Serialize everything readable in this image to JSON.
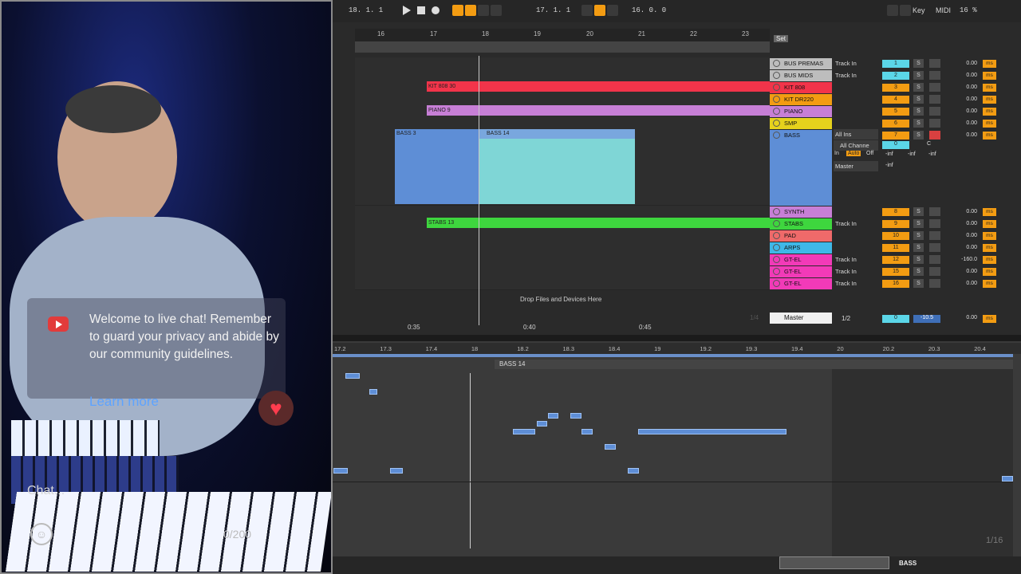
{
  "webcam": {
    "chat_message": "Welcome to live chat! Remember to guard your privacy and abide by our community guidelines.",
    "learn_more": "Learn more",
    "chat_placeholder": "Chat...",
    "char_count": "0/200"
  },
  "transport": {
    "arrangement_position": "18.  1.  1",
    "loop_start": "17.  1.  1",
    "loop_length": "16.  0.  0",
    "key_label": "Key",
    "midi_label": "MIDI",
    "cpu": "16 %"
  },
  "arrangement": {
    "bar_numbers": [
      "16",
      "17",
      "18",
      "19",
      "20",
      "21",
      "22",
      "23"
    ],
    "set_label": "Set",
    "drop_hint": "Drop Files and Devices Here",
    "time_labels": [
      "0:35",
      "0:40",
      "0:45"
    ],
    "grid_label": "1/4",
    "clips": {
      "kit808": "KIT 808 30",
      "piano": "PIANO 9",
      "bass3": "BASS 3",
      "bass14": "BASS 14",
      "stabs": "STABS 13"
    },
    "tracks": [
      {
        "name": "BUS PREMAS",
        "color": "#bdbdbd",
        "input": "Track In",
        "num": "1",
        "numcolor": "#5bd6e8",
        "vol": "0.00"
      },
      {
        "name": "BUS MIDS",
        "color": "#bdbdbd",
        "input": "Track In",
        "num": "2",
        "numcolor": "#5bd6e8",
        "vol": "0.00"
      },
      {
        "name": "KIT 808",
        "color": "#f2344a",
        "input": "",
        "num": "3",
        "numcolor": "#f39c12",
        "vol": "0.00"
      },
      {
        "name": "KIT DR220",
        "color": "#f39c12",
        "input": "",
        "num": "4",
        "numcolor": "#f39c12",
        "vol": "0.00"
      },
      {
        "name": "PIANO",
        "color": "#c77fd6",
        "input": "",
        "num": "5",
        "numcolor": "#f39c12",
        "vol": "0.00"
      },
      {
        "name": "SMP",
        "color": "#e6d21c",
        "input": "",
        "num": "6",
        "numcolor": "#f39c12",
        "vol": "0.00"
      },
      {
        "name": "BASS",
        "color": "#5e8ed6",
        "input": "All Ins",
        "num": "7",
        "numcolor": "#f39c12",
        "vol": "0.00"
      },
      {
        "name": "SYNTH",
        "color": "#c77fd6",
        "input": "",
        "num": "8",
        "numcolor": "#f39c12",
        "vol": "0.00"
      },
      {
        "name": "STABS",
        "color": "#3ed63e",
        "input": "Track In",
        "num": "9",
        "numcolor": "#f39c12",
        "vol": "0.00"
      },
      {
        "name": "PAD",
        "color": "#ef6a6a",
        "input": "",
        "num": "10",
        "numcolor": "#f39c12",
        "vol": "0.00"
      },
      {
        "name": "ARPS",
        "color": "#3fb8e8",
        "input": "",
        "num": "11",
        "numcolor": "#f39c12",
        "vol": "0.00"
      },
      {
        "name": "GT-EL",
        "color": "#f23ab8",
        "input": "Track In",
        "num": "12",
        "numcolor": "#f39c12",
        "vol": "-160.0"
      },
      {
        "name": "GT-EL",
        "color": "#f23ab8",
        "input": "Track In",
        "num": "15",
        "numcolor": "#f39c12",
        "vol": "0.00"
      },
      {
        "name": "GT-EL",
        "color": "#f23ab8",
        "input": "Track In",
        "num": "16",
        "numcolor": "#f39c12",
        "vol": "0.00"
      }
    ],
    "bass_io": {
      "channel": "All Channe",
      "in": "In",
      "auto": "Auto",
      "off": "Off",
      "output": "Master",
      "inf": "-inf",
      "zero": "0",
      "pan": "C"
    },
    "master": {
      "name": "Master",
      "output": "1/2",
      "num": "0",
      "vol": "-10.5",
      "vol2": "0.00"
    },
    "ms_label": "ms",
    "s_label": "S"
  },
  "piano_roll": {
    "ruler": [
      "17.2",
      "17.3",
      "17.4",
      "18",
      "18.2",
      "18.3",
      "18.4",
      "19",
      "19.2",
      "19.3",
      "19.4",
      "20",
      "20.2",
      "20.3",
      "20.4"
    ],
    "clip_name": "BASS 14",
    "track_name": "BASS",
    "grid": "1/16"
  }
}
